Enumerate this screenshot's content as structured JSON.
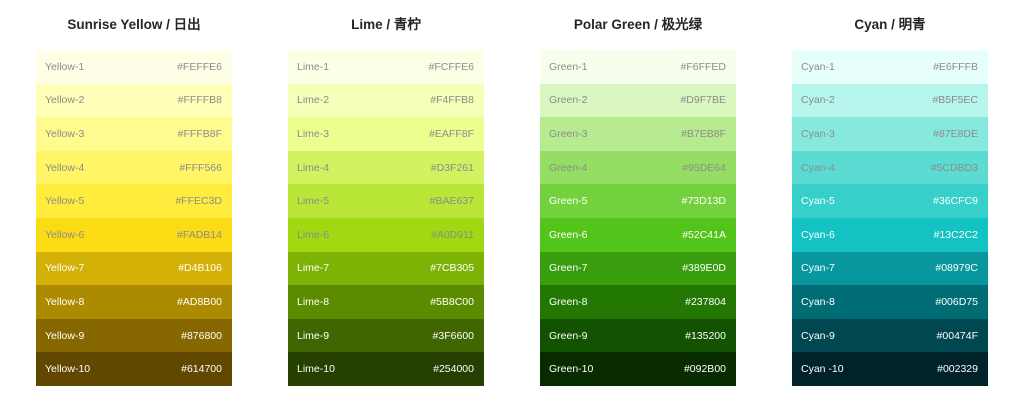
{
  "palettes": [
    {
      "title": "Sunrise Yellow / 日出",
      "swatches": [
        {
          "name": "Yellow-1",
          "hex": "#FEFFE6",
          "bg": "#FEFFE6",
          "text": "#8c8c8c"
        },
        {
          "name": "Yellow-2",
          "hex": "#FFFFB8",
          "bg": "#FFFFB8",
          "text": "#8c8c8c"
        },
        {
          "name": "Yellow-3",
          "hex": "#FFFB8F",
          "bg": "#FFFB8F",
          "text": "#8c8c8c"
        },
        {
          "name": "Yellow-4",
          "hex": "#FFF566",
          "bg": "#FFF566",
          "text": "#8c8c8c"
        },
        {
          "name": "Yellow-5",
          "hex": "#FFEC3D",
          "bg": "#FFEC3D",
          "text": "#8c8c8c"
        },
        {
          "name": "Yellow-6",
          "hex": "#FADB14",
          "bg": "#FADB14",
          "text": "#8c8c8c"
        },
        {
          "name": "Yellow-7",
          "hex": "#D4B106",
          "bg": "#D4B106",
          "text": "#ffffff"
        },
        {
          "name": "Yellow-8",
          "hex": "#AD8B00",
          "bg": "#AD8B00",
          "text": "#ffffff"
        },
        {
          "name": "Yellow-9",
          "hex": "#876800",
          "bg": "#876800",
          "text": "#ffffff"
        },
        {
          "name": "Yellow-10",
          "hex": "#614700",
          "bg": "#614700",
          "text": "#ffffff"
        }
      ]
    },
    {
      "title": "Lime / 青柠",
      "swatches": [
        {
          "name": "Lime-1",
          "hex": "#FCFFE6",
          "bg": "#FCFFE6",
          "text": "#8c8c8c"
        },
        {
          "name": "Lime-2",
          "hex": "#F4FFB8",
          "bg": "#F4FFB8",
          "text": "#8c8c8c"
        },
        {
          "name": "Lime-3",
          "hex": "#EAFF8F",
          "bg": "#EAFF8F",
          "text": "#8c8c8c"
        },
        {
          "name": "Lime-4",
          "hex": "#D3F261",
          "bg": "#D3F261",
          "text": "#8c8c8c"
        },
        {
          "name": "Lime-5",
          "hex": "#BAE637",
          "bg": "#BAE637",
          "text": "#8c8c8c"
        },
        {
          "name": "Lime-6",
          "hex": "#A0D911",
          "bg": "#A0D911",
          "text": "#8c8c8c"
        },
        {
          "name": "Lime-7",
          "hex": "#7CB305",
          "bg": "#7CB305",
          "text": "#ffffff"
        },
        {
          "name": "Lime-8",
          "hex": "#5B8C00",
          "bg": "#5B8C00",
          "text": "#ffffff"
        },
        {
          "name": "Lime-9",
          "hex": "#3F6600",
          "bg": "#3F6600",
          "text": "#ffffff"
        },
        {
          "name": "Lime-10",
          "hex": "#254000",
          "bg": "#254000",
          "text": "#ffffff"
        }
      ]
    },
    {
      "title": "Polar Green / 极光绿",
      "swatches": [
        {
          "name": "Green-1",
          "hex": "#F6FFED",
          "bg": "#F6FFED",
          "text": "#8c8c8c"
        },
        {
          "name": "Green-2",
          "hex": "#D9F7BE",
          "bg": "#D9F7BE",
          "text": "#8c8c8c"
        },
        {
          "name": "Green-3",
          "hex": "#B7EB8F",
          "bg": "#B7EB8F",
          "text": "#8c8c8c"
        },
        {
          "name": "Green-4",
          "hex": "#95DE64",
          "bg": "#95DE64",
          "text": "#8c8c8c"
        },
        {
          "name": "Green-5",
          "hex": "#73D13D",
          "bg": "#73D13D",
          "text": "#ffffff"
        },
        {
          "name": "Green-6",
          "hex": "#52C41A",
          "bg": "#52C41A",
          "text": "#ffffff"
        },
        {
          "name": "Green-7",
          "hex": "#389E0D",
          "bg": "#389E0D",
          "text": "#ffffff"
        },
        {
          "name": "Green-8",
          "hex": "#237804",
          "bg": "#237804",
          "text": "#ffffff"
        },
        {
          "name": "Green-9",
          "hex": "#135200",
          "bg": "#135200",
          "text": "#ffffff"
        },
        {
          "name": "Green-10",
          "hex": "#092B00",
          "bg": "#092B00",
          "text": "#ffffff"
        }
      ]
    },
    {
      "title": "Cyan / 明青",
      "swatches": [
        {
          "name": "Cyan-1",
          "hex": "#E6FFFB",
          "bg": "#E6FFFB",
          "text": "#8c8c8c"
        },
        {
          "name": "Cyan-2",
          "hex": "#B5F5EC",
          "bg": "#B5F5EC",
          "text": "#8c8c8c"
        },
        {
          "name": "Cyan-3",
          "hex": "#87E8DE",
          "bg": "#87E8DE",
          "text": "#8c8c8c"
        },
        {
          "name": "Cyan-4",
          "hex": "#5CDBD3",
          "bg": "#5CDBD3",
          "text": "#8c8c8c"
        },
        {
          "name": "Cyan-5",
          "hex": "#36CFC9",
          "bg": "#36CFC9",
          "text": "#ffffff"
        },
        {
          "name": "Cyan-6",
          "hex": "#13C2C2",
          "bg": "#13C2C2",
          "text": "#ffffff"
        },
        {
          "name": "Cyan-7",
          "hex": "#08979C",
          "bg": "#08979C",
          "text": "#ffffff"
        },
        {
          "name": "Cyan-8",
          "hex": "#006D75",
          "bg": "#006D75",
          "text": "#ffffff"
        },
        {
          "name": "Cyan-9",
          "hex": "#00474F",
          "bg": "#00474F",
          "text": "#ffffff"
        },
        {
          "name": "Cyan -10",
          "hex": "#002329",
          "bg": "#002329",
          "text": "#ffffff"
        }
      ]
    }
  ]
}
